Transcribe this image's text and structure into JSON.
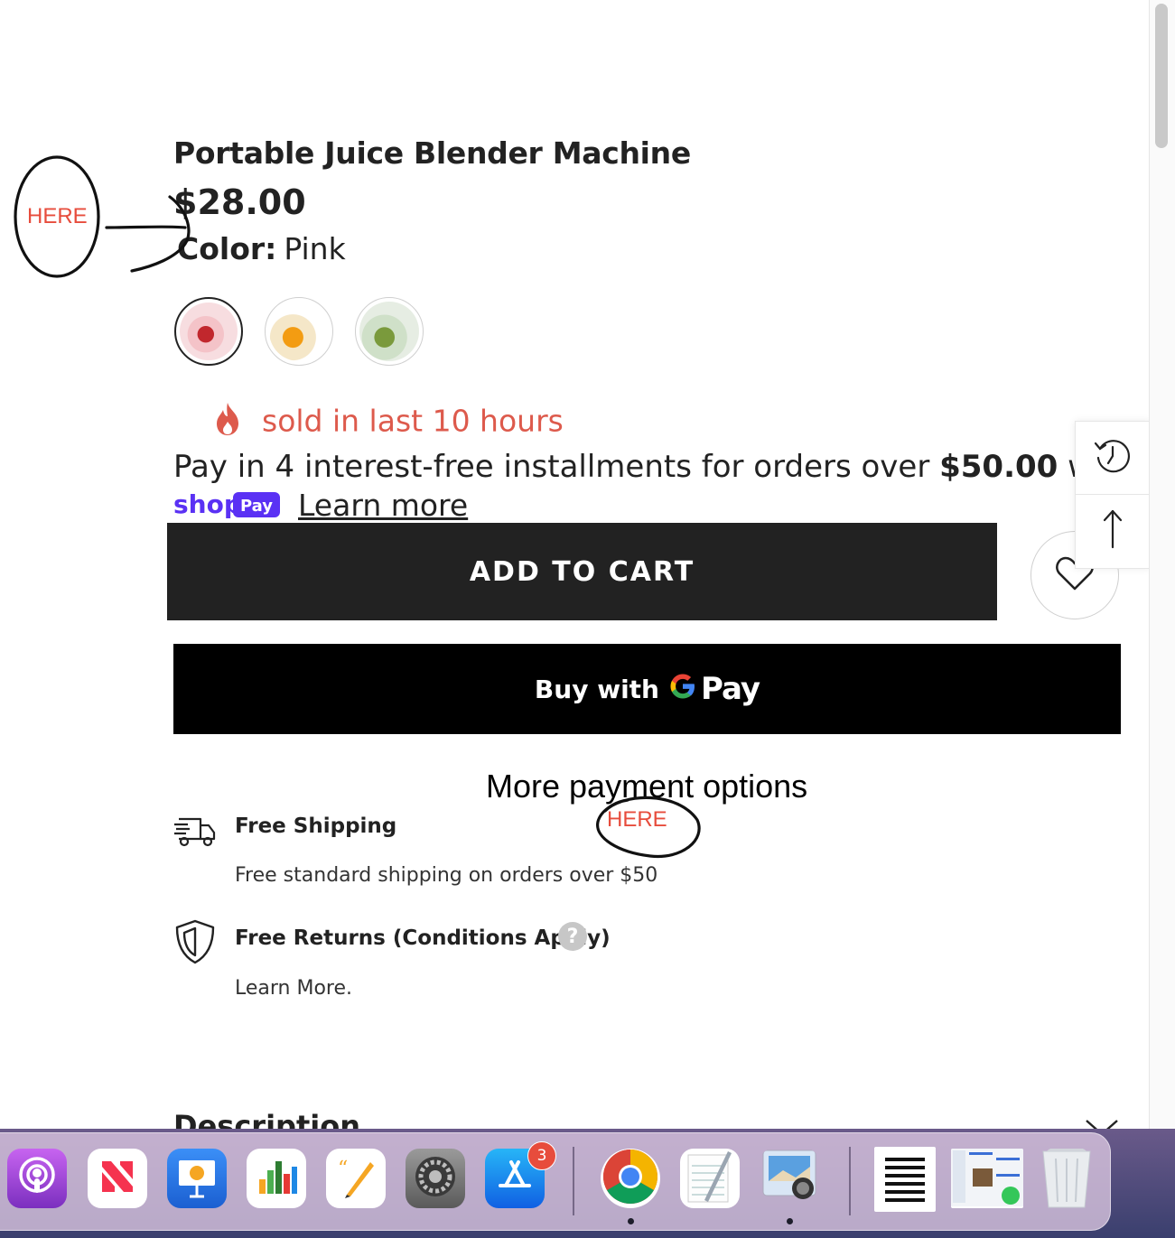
{
  "product": {
    "title": "Portable Juice Blender Machine",
    "price": "$28.00",
    "color_label": "Color:",
    "color_value": "Pink",
    "swatches": [
      "Pink",
      "Orange",
      "Green"
    ],
    "selected_swatch": 0
  },
  "urgency": {
    "text": "sold in last 10 hours",
    "color": "#dd5a4c"
  },
  "installments": {
    "text_before": "Pay in 4 interest-free installments for orders over ",
    "amount": "$50.00",
    "text_after": " with",
    "shop_logo_word": "shop",
    "shop_logo_badge": "Pay",
    "learn_more": "Learn more",
    "brand_color": "#5a31f4"
  },
  "actions": {
    "add_to_cart": "ADD TO CART",
    "buy_with": "Buy with",
    "gpay_word": "Pay",
    "more_payment": "More payment options"
  },
  "features": [
    {
      "title": "Free Shipping",
      "desc": "Free standard shipping on orders over $50",
      "icon": "truck-icon"
    },
    {
      "title": "Free Returns (Conditions Apply)",
      "desc": "Learn More.",
      "icon": "shield-icon",
      "help": "?"
    }
  ],
  "description_heading": "Description",
  "annotations": {
    "here_1": "HERE",
    "here_2": "HERE"
  },
  "dock": {
    "apps": [
      "Podcasts",
      "News",
      "Keynote",
      "Numbers",
      "Pages",
      "System Settings",
      "App Store",
      "Google Chrome",
      "TextEdit",
      "Preview",
      "Document",
      "Screenshot",
      "Trash"
    ],
    "app_store_badge": "3"
  },
  "colors": {
    "button_dark": "#222222",
    "gpay_bg": "#000000",
    "here_red": "#e74c3c"
  }
}
